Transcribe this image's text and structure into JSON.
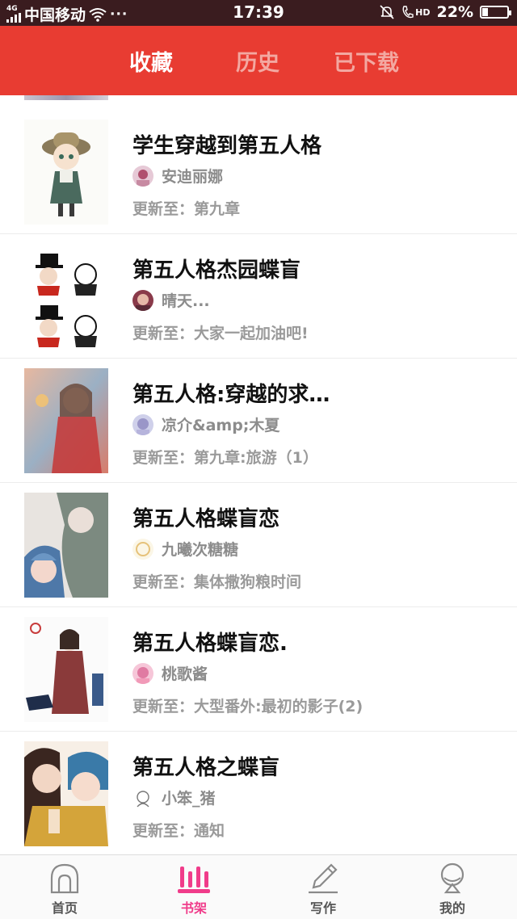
{
  "status_bar": {
    "network_type": "4G",
    "carrier": "中国移动",
    "dots": "···",
    "time": "17:39",
    "hd_label": "HD",
    "battery_text": "22%",
    "battery_level": 0.22
  },
  "header": {
    "tabs": [
      {
        "label": "收藏",
        "active": true
      },
      {
        "label": "历史",
        "active": false
      },
      {
        "label": "已下载",
        "active": false
      }
    ]
  },
  "books": [
    {
      "title": "学生穿越到第五人格",
      "author": "安迪丽娜",
      "update": "更新至：第九章"
    },
    {
      "title": "第五人格杰园蝶盲",
      "author": "晴天...",
      "update": "更新至：大家一起加油吧!"
    },
    {
      "title": "第五人格:穿越的求…",
      "author": "凉介&amp;木夏",
      "update": "更新至：第九章:旅游（1）"
    },
    {
      "title": "第五人格蝶盲恋",
      "author": "九曦次糖糖",
      "update": "更新至：集体撒狗粮时间"
    },
    {
      "title": "第五人格蝶盲恋.",
      "author": "桃歌酱",
      "update": "更新至：大型番外:最初的影子(2)"
    },
    {
      "title": "第五人格之蝶盲",
      "author": "小笨_猪",
      "update": "更新至：通知"
    }
  ],
  "bottom_nav": {
    "items": [
      {
        "label": "首页",
        "icon": "home-icon",
        "active": false
      },
      {
        "label": "书架",
        "icon": "bookshelf-icon",
        "active": true
      },
      {
        "label": "写作",
        "icon": "pencil-icon",
        "active": false
      },
      {
        "label": "我的",
        "icon": "profile-icon",
        "active": false
      }
    ]
  },
  "colors": {
    "header_red": "#e83c32",
    "nav_active_pink": "#f03c8a",
    "status_bar": "#3a1c1f"
  }
}
